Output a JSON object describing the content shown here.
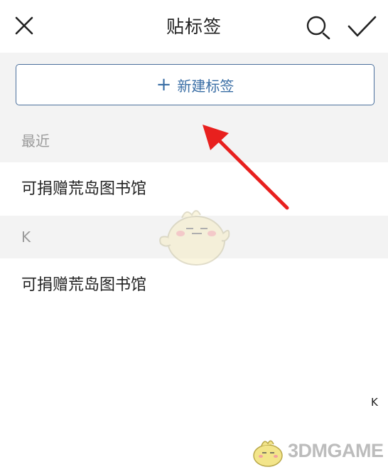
{
  "header": {
    "title": "贴标签",
    "close_icon": "close-icon",
    "search_icon": "search-icon",
    "confirm_icon": "check-icon"
  },
  "new_tag": {
    "label": "新建标签",
    "icon": "plus-icon",
    "accent_color": "#3a6ea5"
  },
  "sections": [
    {
      "header": "最近",
      "items": [
        "可捐赠荒岛图书馆"
      ]
    },
    {
      "header": "K",
      "items": [
        "可捐赠荒岛图书馆"
      ]
    }
  ],
  "index_bar": [
    "K"
  ],
  "overlay": {
    "arrow_color": "#e8201e",
    "watermark_text": "3DMGAME"
  }
}
